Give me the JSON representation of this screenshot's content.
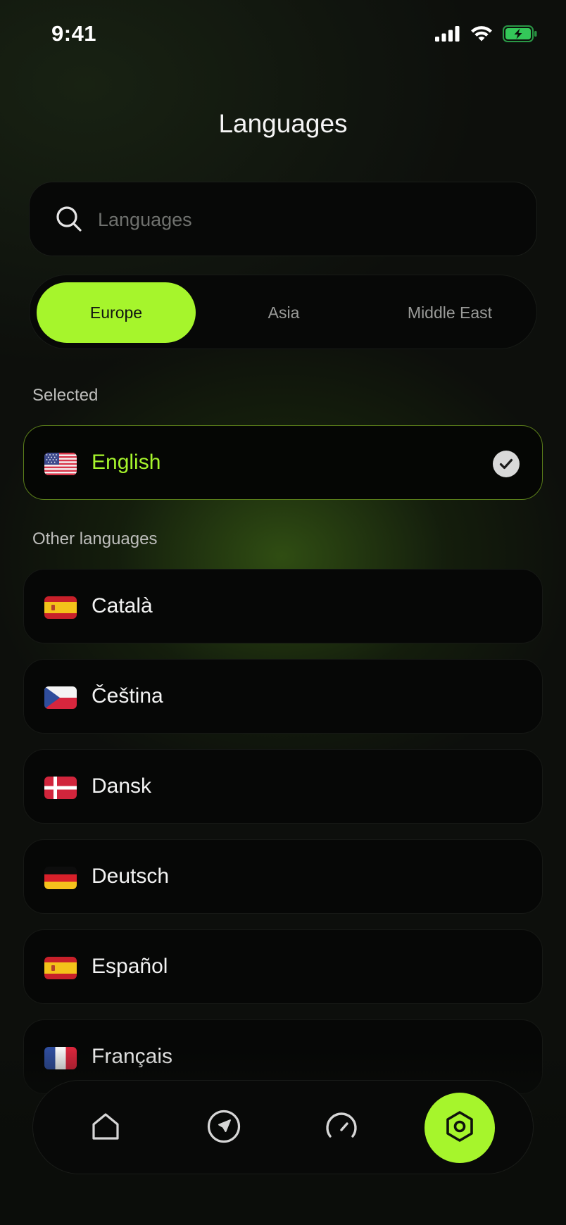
{
  "status_bar": {
    "time": "9:41",
    "icons": [
      "cellular-signal-icon",
      "wifi-icon",
      "battery-charging-icon"
    ],
    "battery_color": "#34c759"
  },
  "header": {
    "title": "Languages"
  },
  "search": {
    "placeholder": "Languages",
    "value": "",
    "icon": "search-icon"
  },
  "region_tabs": [
    {
      "label": "Europe",
      "active": true
    },
    {
      "label": "Asia",
      "active": false
    },
    {
      "label": "Middle East",
      "active": false
    }
  ],
  "selected_section": {
    "label": "Selected",
    "items": [
      {
        "label": "English",
        "flag": "us-flag-icon",
        "checked": true
      }
    ]
  },
  "other_section": {
    "label": "Other languages",
    "items": [
      {
        "label": "Català",
        "flag": "spain-flag-icon"
      },
      {
        "label": "Čeština",
        "flag": "czech-flag-icon"
      },
      {
        "label": "Dansk",
        "flag": "denmark-flag-icon"
      },
      {
        "label": "Deutsch",
        "flag": "germany-flag-icon"
      },
      {
        "label": "Español",
        "flag": "spain-flag-icon"
      },
      {
        "label": "Français",
        "flag": "france-flag-icon"
      }
    ]
  },
  "tab_bar": {
    "items": [
      {
        "icon": "home-icon",
        "active": false
      },
      {
        "icon": "navigation-icon",
        "active": false
      },
      {
        "icon": "speedometer-icon",
        "active": false
      },
      {
        "icon": "settings-icon",
        "active": true
      }
    ]
  },
  "colors": {
    "accent": "#a6f52c",
    "background": "#0d0f0c",
    "card": "#060706"
  }
}
